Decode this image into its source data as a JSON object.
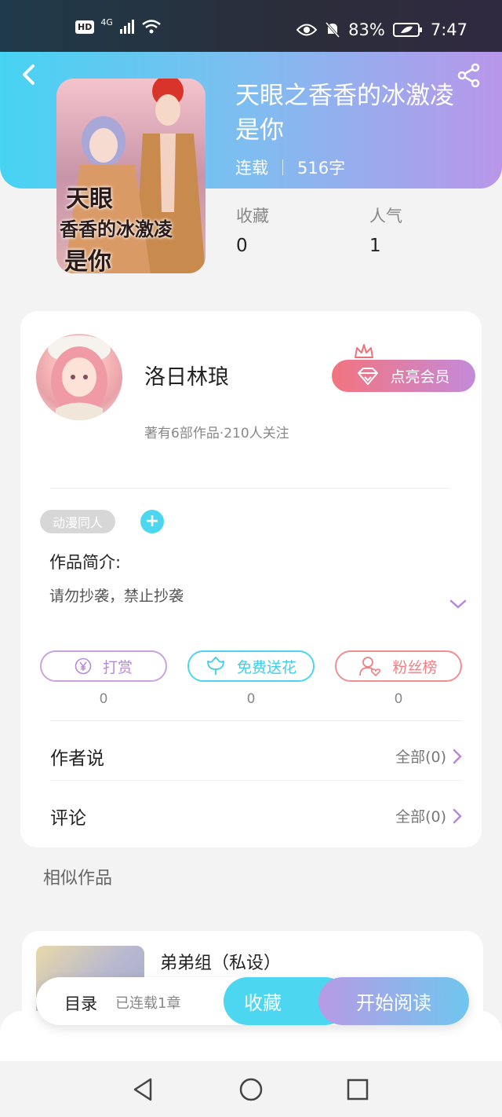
{
  "status_bar": {
    "left_badge": "HD",
    "network": "4G",
    "battery_percent": "83%",
    "time": "7:47"
  },
  "book": {
    "title": "天眼之香香的冰激凌是你",
    "cover_title_line1": "天眼",
    "cover_title_line2": "香香的冰激凌",
    "cover_title_line3": "是你",
    "status": "连载",
    "word_count": "516字",
    "collect_label": "收藏",
    "collect_value": "0",
    "popularity_label": "人气",
    "popularity_value": "1"
  },
  "author": {
    "name": "洛日林琅",
    "info": "著有6部作品·210人关注",
    "vip_button": "点亮会员"
  },
  "tags": [
    "动漫同人"
  ],
  "intro": {
    "label": "作品简介:",
    "text": "请勿抄袭，禁止抄袭"
  },
  "actions": [
    {
      "label": "打赏",
      "count": "0",
      "color": "#b888d8"
    },
    {
      "label": "免费送花",
      "count": "0",
      "color": "#3fcde8"
    },
    {
      "label": "粉丝榜",
      "count": "0",
      "color": "#ef7f83"
    }
  ],
  "rows": [
    {
      "label": "作者说",
      "right": "全部(0)"
    },
    {
      "label": "评论",
      "right": "全部(0)"
    }
  ],
  "similar": {
    "section_title": "相似作品",
    "first_title": "弟弟组（私设）"
  },
  "bottom_bar": {
    "toc": "目录",
    "toc_sub": "已连载1章",
    "favorite": "收藏",
    "start_reading": "开始阅读"
  },
  "colors": {
    "header_gradient_start": "#47d3f2",
    "header_gradient_end": "#b996ea",
    "accent_cyan": "#4dd6f0",
    "accent_purple": "#b888d8"
  },
  "icons": [
    "back-icon",
    "share-icon",
    "diamond-icon",
    "crown-icon",
    "yen-icon",
    "flower-icon",
    "fans-icon",
    "chevron-right-icon",
    "chevron-down-icon"
  ]
}
